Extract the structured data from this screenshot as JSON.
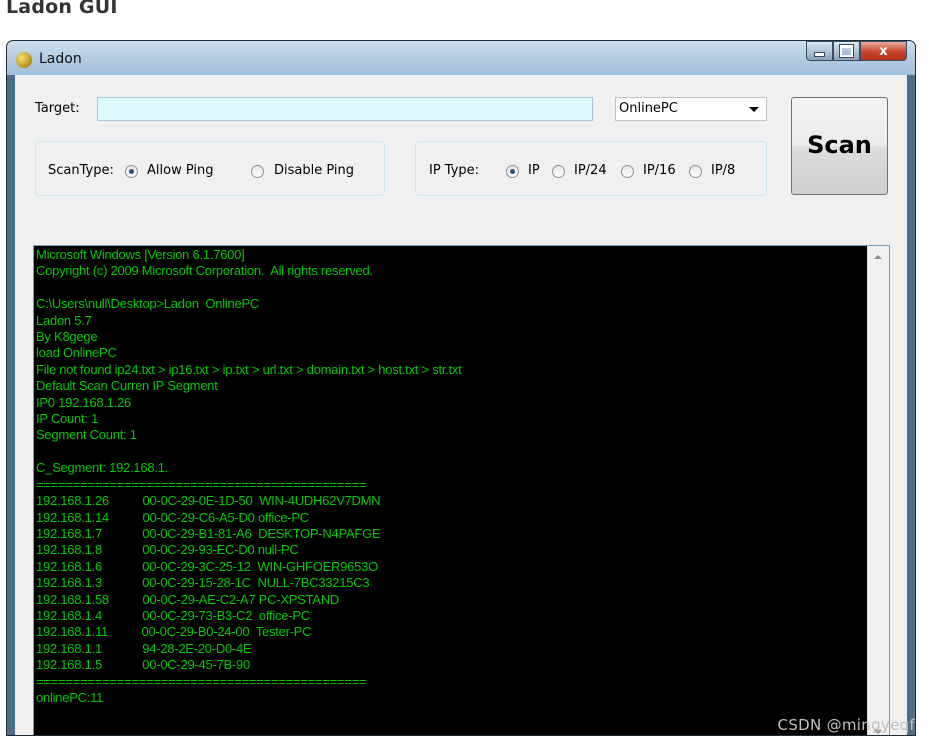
{
  "page": {
    "heading": "Ladon GUI"
  },
  "window": {
    "title": "Ladon",
    "icon": "lemon-app-icon",
    "min_label": "",
    "max_label": "",
    "close_label": "x"
  },
  "form": {
    "target_label": "Target:",
    "target_value": "",
    "mode_value": "OnlinePC",
    "scan_label": "Scan",
    "scantype_label": "ScanType:",
    "scantype_options": [
      "Allow Ping",
      "Disable Ping"
    ],
    "scantype_selected": "Allow Ping",
    "iptype_label": "IP Type:",
    "iptype_options": [
      "IP",
      "IP/24",
      "IP/16",
      "IP/8"
    ],
    "iptype_selected": "IP"
  },
  "console": {
    "text_color": "#00c800",
    "lines": [
      "Microsoft Windows [Version 6.1.7600]",
      "Copyright (c) 2009 Microsoft Corporation.  All rights reserved.",
      "",
      "C:\\Users\\null\\Desktop>Ladon  OnlinePC",
      "Ladon 5.7",
      "By K8gege",
      "load OnlinePC",
      "File not found ip24.txt > ip16.txt > ip.txt > url.txt > domain.txt > host.txt > str.txt",
      "Default Scan Curren IP Segment",
      "IP0 192.168.1.26",
      "IP Count: 1",
      "Segment Count: 1",
      "",
      "C_Segment: 192.168.1.",
      "=============================================",
      "192.168.1.26          00-0C-29-0E-1D-50  WIN-4UDH62V7DMN",
      "192.168.1.14          00-0C-29-C6-A5-D0 office-PC",
      "192.168.1.7            00-0C-29-B1-81-A6  DESKTOP-N4PAFGE",
      "192.168.1.8            00-0C-29-93-EC-D0 null-PC",
      "192.168.1.6            00-0C-29-3C-25-12  WIN-GHFOER9653O",
      "192.168.1.3            00-0C-29-15-28-1C  NULL-7BC33215C3",
      "192.168.1.58          00-0C-29-AE-C2-A7 PC-XPSTAND",
      "192.168.1.4            00-0C-29-73-B3-C2  office-PC",
      "192.168.1.11          00-0C-29-B0-24-00  Tester-PC",
      "192.168.1.1            94-28-2E-20-D0-4E",
      "192.168.1.5            00-0C-29-45-7B-90",
      "=============================================",
      "onlinePC:11"
    ]
  },
  "watermark": "CSDN @mingyeqf"
}
